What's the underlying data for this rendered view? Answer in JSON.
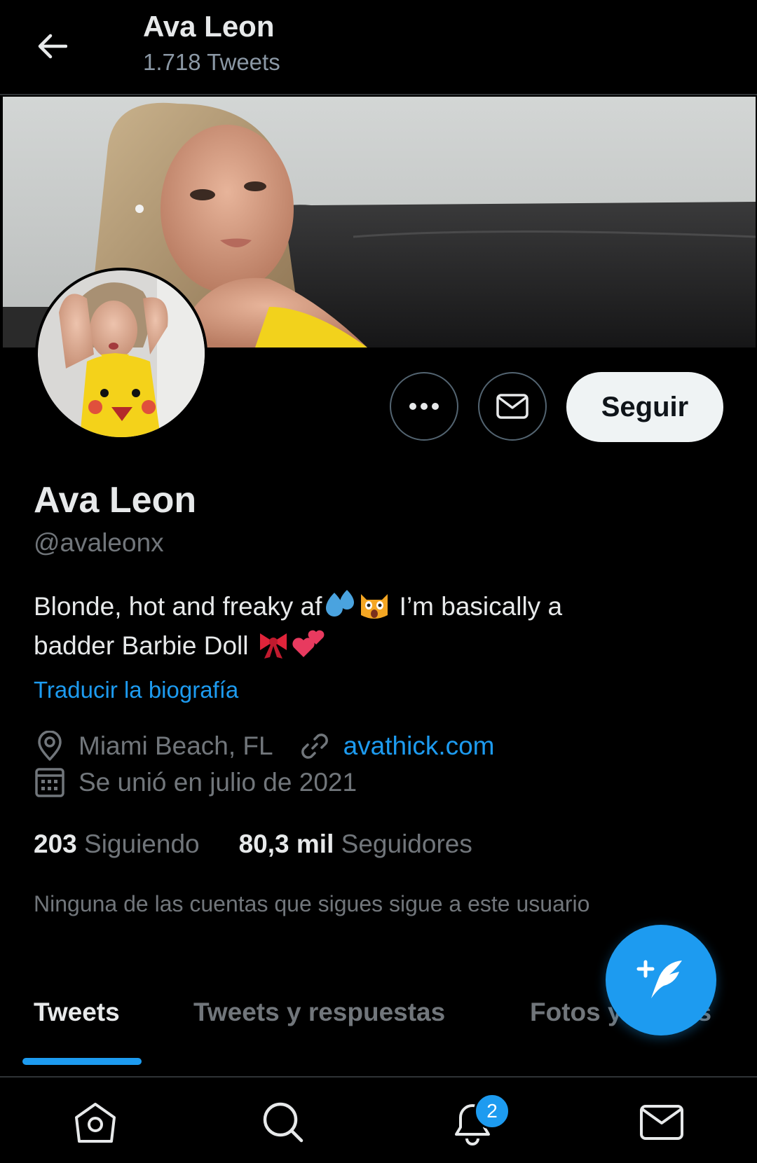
{
  "header": {
    "title": "Ava Leon",
    "tweet_count": "1.718 Tweets"
  },
  "profile": {
    "name": "Ava Leon",
    "handle": "@avaleonx",
    "bio_line1_text": "Blonde, hot and freaky af",
    "bio_line1_rest": " I’m basically a",
    "bio_line2_text": "badder Barbie Doll ",
    "bio_emojis": [
      "sweat-droplets",
      "weary-cat",
      "ribbon",
      "two-hearts"
    ],
    "translate_label": "Traducir la biografía",
    "location": "Miami Beach, FL",
    "website": "avathick.com",
    "joined": "Se unió en julio de 2021",
    "following_count": "203",
    "following_label": "Siguiendo",
    "followers_count": "80,3 mil",
    "followers_label": "Seguidores",
    "mutual_note": "Ninguna de las cuentas que sigues sigue a este usuario"
  },
  "actions": {
    "follow_label": "Seguir"
  },
  "tabs": [
    {
      "label": "Tweets",
      "active": true
    },
    {
      "label": "Tweets y respuestas",
      "active": false
    },
    {
      "label": "Fotos y videos",
      "active": false
    }
  ],
  "bottom_nav": {
    "items": [
      "home-icon",
      "search-icon",
      "notifications-icon",
      "messages-icon"
    ],
    "notification_badge": "2"
  },
  "colors": {
    "accent": "#1d9bf0",
    "background": "#000000",
    "text_primary": "#e7e9ea",
    "text_secondary": "#71767b"
  }
}
